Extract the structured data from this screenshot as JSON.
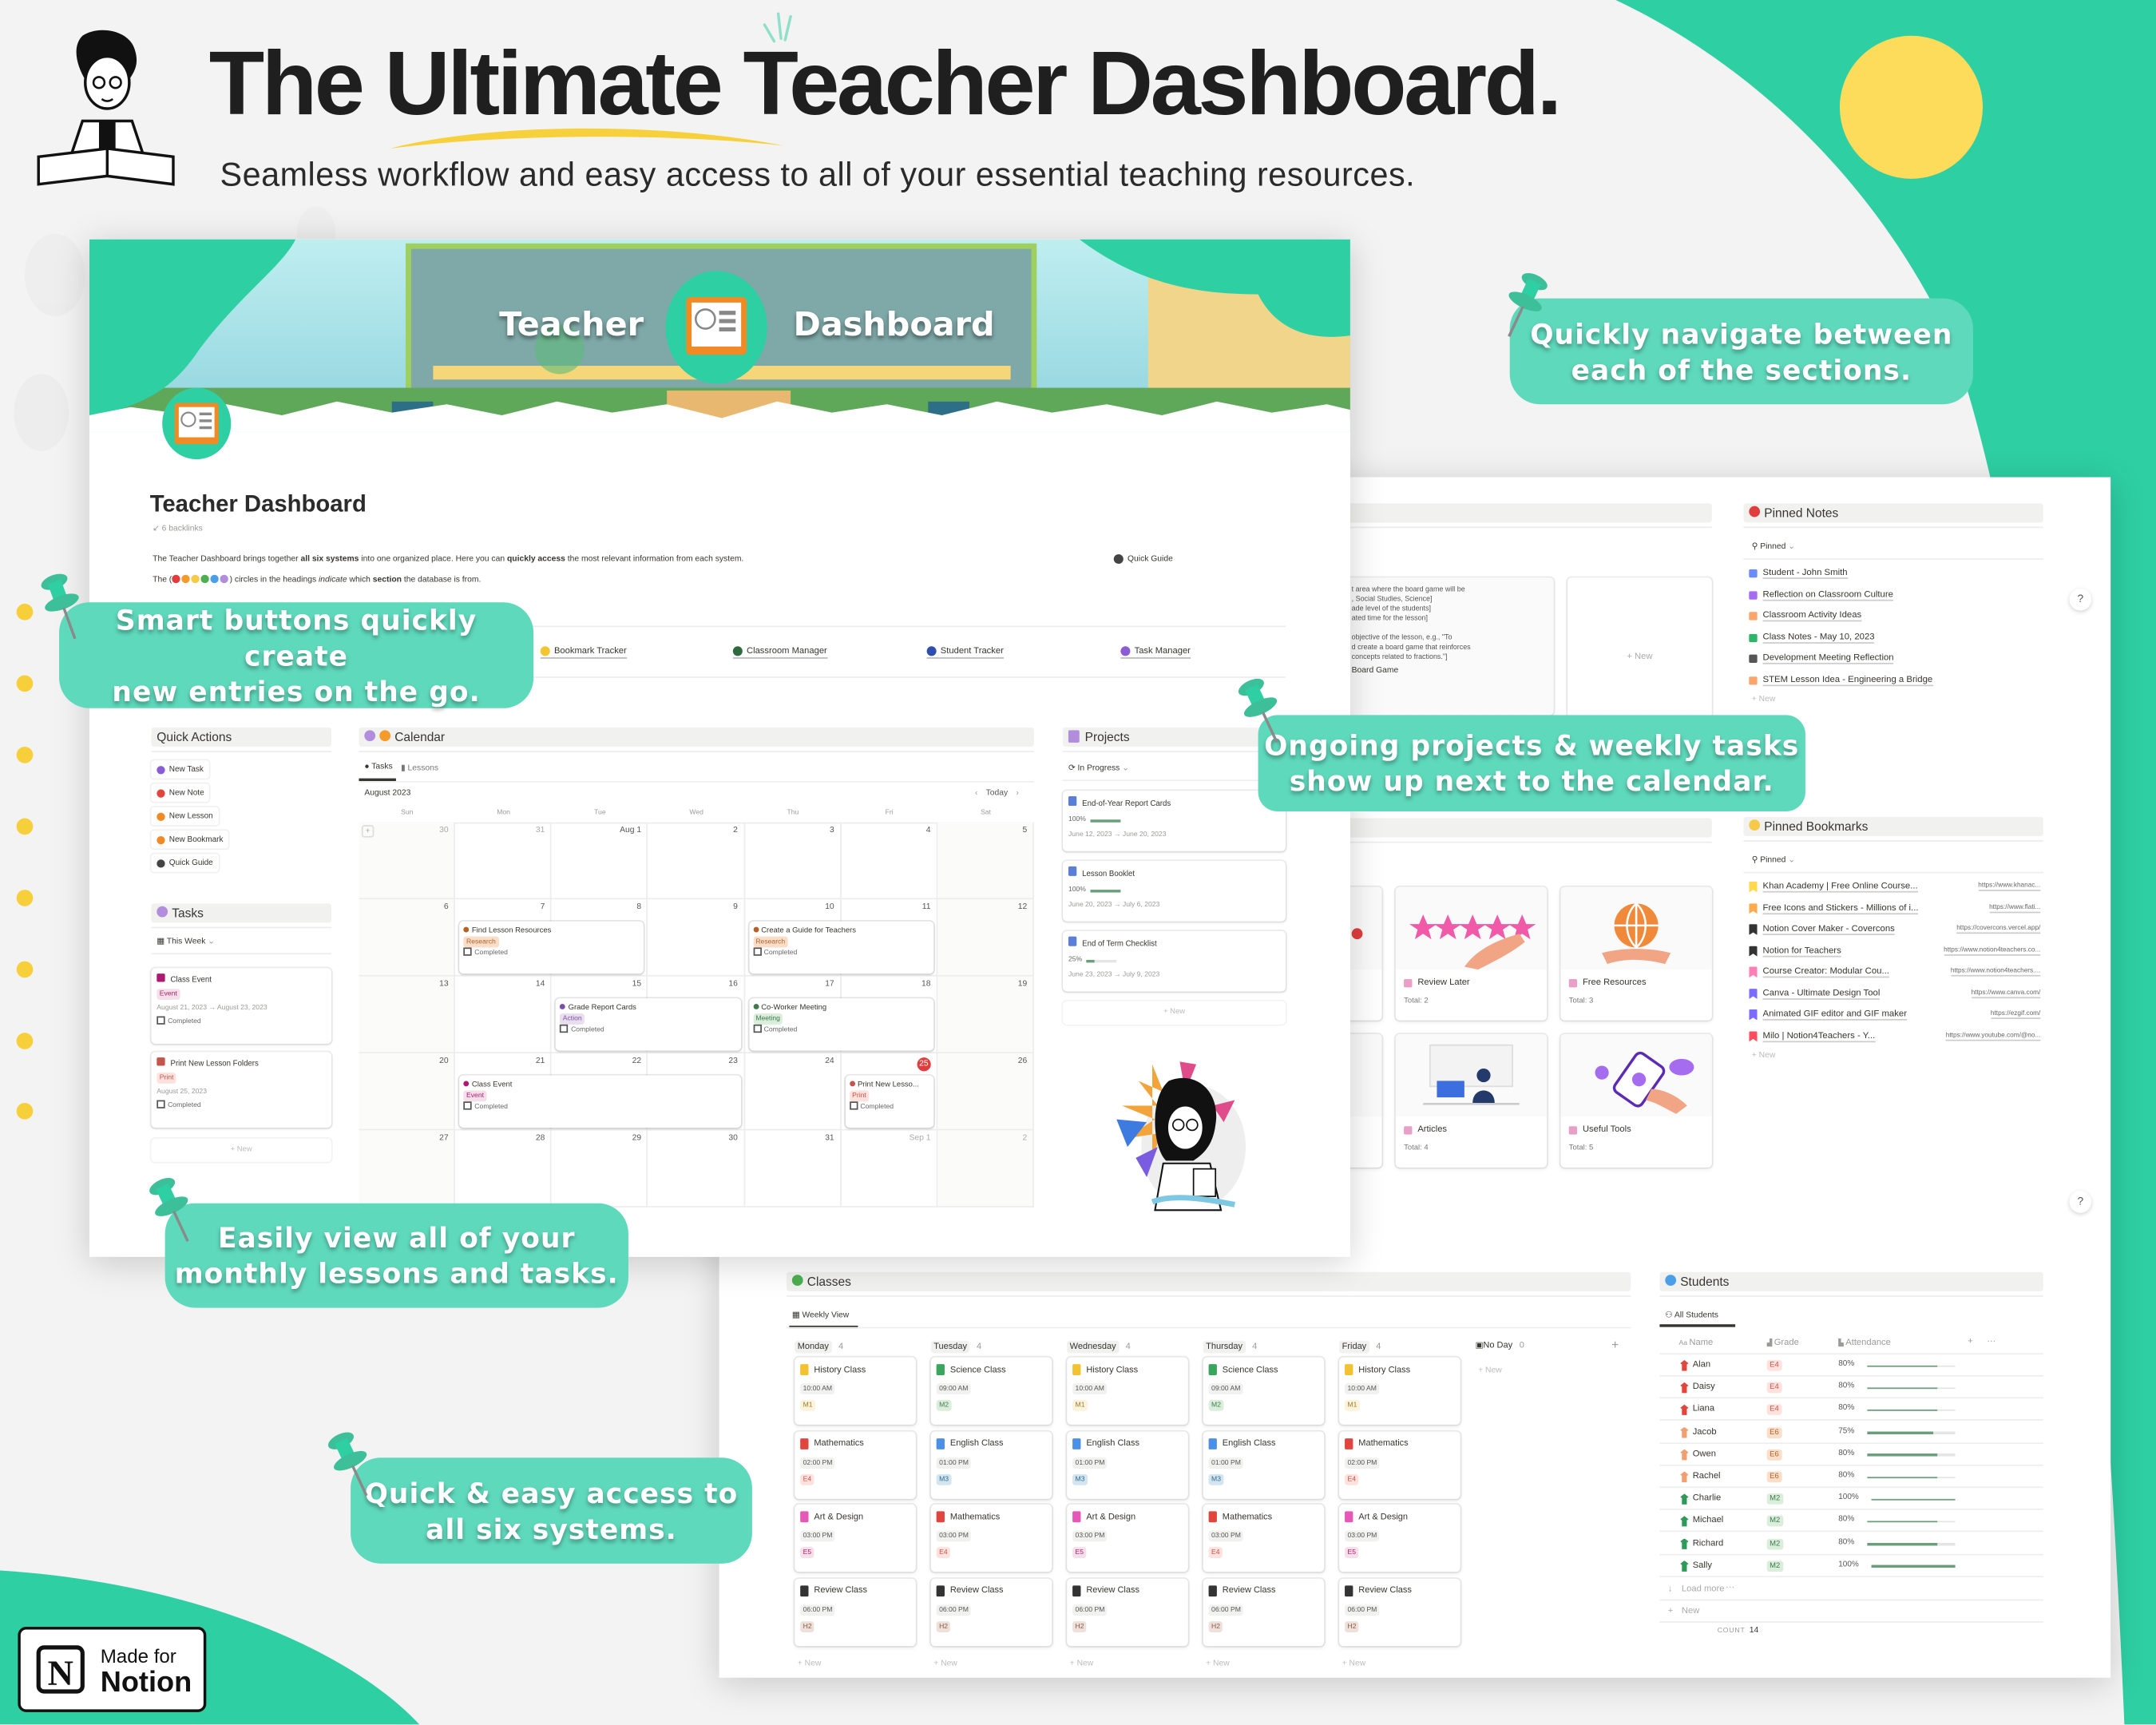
{
  "header": {
    "title_pre": "The ",
    "title_highlight": "Ultimate",
    "title_post": " Teacher Dashboard.",
    "subtitle": "Seamless workflow and easy access to all of your essential teaching resources."
  },
  "colors": {
    "teal": "#2ecfa3",
    "callout": "#5fd9bc",
    "yellow": "#fddc5c",
    "today": "#e03e3e",
    "progress": "#6b9e7c"
  },
  "callouts": [
    {
      "line1": "Quickly navigate between",
      "line2": "each of the sections."
    },
    {
      "line1": "Smart buttons quickly create",
      "line2": "new entries on the go."
    },
    {
      "line1": "Ongoing projects & weekly tasks",
      "line2": "show up next to the calendar."
    },
    {
      "line1": "Easily view all of your",
      "line2": "monthly lessons and tasks."
    },
    {
      "line1": "Quick & easy access to",
      "line2": "all six systems."
    }
  ],
  "badge": {
    "line1": "Made for",
    "line2": "Notion"
  },
  "dashboard": {
    "banner": {
      "left": "Teacher",
      "right": "Dashboard"
    },
    "title": "Teacher Dashboard",
    "backlinks": "6 backlinks",
    "description": {
      "p1": "The Teacher Dashboard brings together ",
      "b1": "all six systems",
      "p2": " into one organized place. Here you can ",
      "b2": "quickly access",
      "p3": " the most relevant information from each system."
    },
    "legend": {
      "p1": "The (",
      "p2": ") circles in the headings ",
      "italic": "indicate",
      "p3": " which ",
      "bold": "section",
      "p4": " the database is from.",
      "circle_colors": [
        "#e03e3e",
        "#f59b2b",
        "#f7c948",
        "#4caf50",
        "#4a9fe8",
        "#b28ddc"
      ]
    },
    "quick_guide": "Quick Guide",
    "systems": [
      {
        "label": "Note Tracker",
        "color": "#6a9a6a"
      },
      {
        "label": "Lesson Planner",
        "color": "#8aa86a"
      },
      {
        "label": "Bookmark Tracker",
        "color": "#f3c531"
      },
      {
        "label": "Classroom Manager",
        "color": "#2f6b3f"
      },
      {
        "label": "Student Tracker",
        "color": "#2f4fb0"
      },
      {
        "label": "Task Manager",
        "color": "#8a5cd6"
      }
    ],
    "quick_actions": {
      "title": "Quick Actions",
      "items": [
        {
          "label": "New Task",
          "icon": "check-circle",
          "color": "#8a5cd6"
        },
        {
          "label": "New Note",
          "icon": "note",
          "color": "#e0463e"
        },
        {
          "label": "New Lesson",
          "icon": "book",
          "color": "#f08a24"
        },
        {
          "label": "New Bookmark",
          "icon": "bookmark",
          "color": "#f08a24"
        },
        {
          "label": "Quick Guide",
          "icon": "info",
          "color": "#444444"
        }
      ]
    },
    "tasks": {
      "title": "Tasks",
      "view": "This Week",
      "cards": [
        {
          "title": "Class Event",
          "tag": "Event",
          "tag_bg": "#f5e0e9",
          "tag_fg": "#ad1a72",
          "date": "August 21, 2023 → August 23, 2023",
          "check": "Completed"
        },
        {
          "title": "Print New Lesson Folders",
          "tag": "Print",
          "tag_bg": "#ffe2dd",
          "tag_fg": "#c4554d",
          "date": "August 25, 2023",
          "check": "Completed"
        }
      ],
      "new": "New"
    },
    "calendar": {
      "title": "Calendar",
      "tabs": [
        "Tasks",
        "Lessons"
      ],
      "month": "August 2023",
      "today_label": "Today",
      "today": 25,
      "days": [
        "Sun",
        "Mon",
        "Tue",
        "Wed",
        "Thu",
        "Fri",
        "Sat"
      ],
      "weeks": [
        [
          "30",
          "31",
          "Aug 1",
          "2",
          "3",
          "4",
          "5"
        ],
        [
          "6",
          "7",
          "8",
          "9",
          "10",
          "11",
          "12"
        ],
        [
          "13",
          "14",
          "15",
          "16",
          "17",
          "18",
          "19"
        ],
        [
          "20",
          "21",
          "22",
          "23",
          "24",
          "25",
          "26"
        ],
        [
          "27",
          "28",
          "29",
          "30",
          "31",
          "Sep 1",
          "2"
        ]
      ],
      "events": [
        {
          "title": "Find Lesson Resources",
          "start": 7,
          "end": 8,
          "tag": "Research",
          "tag_bg": "#fadec9",
          "tag_fg": "#b0642a",
          "check": "Completed"
        },
        {
          "title": "Create a Guide for Teachers",
          "start": 10,
          "end": 11,
          "tag": "Research",
          "tag_bg": "#fadec9",
          "tag_fg": "#b0642a",
          "check": "Completed"
        },
        {
          "title": "Grade Report Cards",
          "start": 15,
          "end": 16,
          "tag": "Action",
          "tag_bg": "#e8deee",
          "tag_fg": "#7d4fa8",
          "check": "Completed"
        },
        {
          "title": "Co-Worker Meeting",
          "start": 17,
          "end": 18,
          "tag": "Meeting",
          "tag_bg": "#dbeddb",
          "tag_fg": "#3f7a4f",
          "check": "Completed"
        },
        {
          "title": "Class Event",
          "start": 21,
          "end": 23,
          "tag": "Event",
          "tag_bg": "#f5e0e9",
          "tag_fg": "#ad1a72",
          "check": "Completed"
        },
        {
          "title": "Print New Lesso...",
          "start": 25,
          "end": 25,
          "tag": "Print",
          "tag_bg": "#ffe2dd",
          "tag_fg": "#c4554d",
          "check": "Completed"
        }
      ]
    },
    "projects": {
      "title": "Projects",
      "view": "In Progress",
      "cards": [
        {
          "title": "End-of-Year Report Cards",
          "progress": 100,
          "progress_label": "100%",
          "dates": "June 12, 2023 → June 20, 2023"
        },
        {
          "title": "Lesson Booklet",
          "progress": 100,
          "progress_label": "100%",
          "dates": "June 20, 2023 → July 6, 2023"
        },
        {
          "title": "End of Term Checklist",
          "progress": 25,
          "progress_label": "25%",
          "dates": "June 23, 2023 → July 9, 2023"
        }
      ],
      "new": "New"
    }
  },
  "workspace": {
    "lesson_preview": [
      "t area where the board game will be",
      ", Social Studies, Science]",
      "ade level of the students]",
      "ated time for the lesson]",
      "objective of the lesson, e.g., \"To",
      "d create a board game that reinforces",
      "concepts related to fractions.\"]"
    ],
    "lesson_title": "Board Game",
    "new": "New",
    "help": "?",
    "pinned_notes": {
      "title": "Pinned Notes",
      "view": "Pinned",
      "items": [
        {
          "label": "Student - John Smith",
          "color": "#6b8cff"
        },
        {
          "label": "Reflection on Classroom Culture",
          "color": "#a56cf0"
        },
        {
          "label": "Classroom Activity Ideas",
          "color": "#f9a56b"
        },
        {
          "label": "Class Notes - May 10, 2023",
          "color": "#2fb56a"
        },
        {
          "label": "Development Meeting Reflection",
          "color": "#555555"
        },
        {
          "label": "STEM Lesson Idea - Engineering a Bridge",
          "color": "#f9a56b"
        }
      ],
      "new": "New"
    },
    "gallery": [
      {
        "label": "Review Later",
        "total": "Total: 2",
        "image": "stars-hand"
      },
      {
        "label": "Free Resources",
        "total": "Total: 3",
        "image": "globe-hand"
      },
      {
        "label": "Articles",
        "total": "Total: 4",
        "image": "person-at-desk"
      },
      {
        "label": "Useful Tools",
        "total": "Total: 5",
        "image": "phone-hand"
      }
    ],
    "pinned_bookmarks": {
      "title": "Pinned Bookmarks",
      "view": "Pinned",
      "items": [
        {
          "label": "Khan Academy | Free Online Course...",
          "url": "https://www.khanac...",
          "color": "#ffd84d"
        },
        {
          "label": "Free Icons and Stickers - Millions of i...",
          "url": "https://www.flati...",
          "color": "#ffa94d"
        },
        {
          "label": "Notion Cover Maker - Covercons",
          "url": "https://covercons.vercel.app/",
          "color": "#333333"
        },
        {
          "label": "Notion for Teachers",
          "url": "https://www.notion4teachers.co...",
          "color": "#333333"
        },
        {
          "label": "Course Creator: Modular Cou...",
          "url": "https://www.notion4teachers....",
          "color": "#ff7eb6"
        },
        {
          "label": "Canva - Ultimate Design Tool",
          "url": "https://www.canva.com/",
          "color": "#7b6cff"
        },
        {
          "label": "Animated GIF editor and GIF maker",
          "url": "https://ezgif.com/",
          "color": "#7b6cff"
        },
        {
          "label": "Milo | Notion4Teachers - Y...",
          "url": "https://www.youtube.com/@no...",
          "color": "#ff4d5e"
        }
      ],
      "new": "New"
    },
    "classes": {
      "title": "Classes",
      "view": "Weekly View",
      "columns": [
        {
          "day": "Monday",
          "count": "4",
          "cards": [
            {
              "title": "History Class",
              "time": "10:00 AM",
              "room": "M1",
              "icon": "scroll"
            },
            {
              "title": "Mathematics",
              "time": "02:00 PM",
              "room": "E4",
              "icon": "calculator"
            },
            {
              "title": "Art & Design",
              "time": "03:00 PM",
              "room": "E5",
              "icon": "paintbrush"
            },
            {
              "title": "Review Class",
              "time": "06:00 PM",
              "room": "H2",
              "icon": "notebook"
            }
          ]
        },
        {
          "day": "Tuesday",
          "count": "4",
          "cards": [
            {
              "title": "Science Class",
              "time": "09:00 AM",
              "room": "M2",
              "icon": "flask"
            },
            {
              "title": "English Class",
              "time": "01:00 PM",
              "room": "M3",
              "icon": "blue-book"
            },
            {
              "title": "Mathematics",
              "time": "03:00 PM",
              "room": "E4",
              "icon": "calculator"
            },
            {
              "title": "Review Class",
              "time": "06:00 PM",
              "room": "H2",
              "icon": "notebook"
            }
          ]
        },
        {
          "day": "Wednesday",
          "count": "4",
          "cards": [
            {
              "title": "History Class",
              "time": "10:00 AM",
              "room": "M1",
              "icon": "scroll"
            },
            {
              "title": "English Class",
              "time": "01:00 PM",
              "room": "M3",
              "icon": "blue-book"
            },
            {
              "title": "Art & Design",
              "time": "03:00 PM",
              "room": "E5",
              "icon": "paintbrush"
            },
            {
              "title": "Review Class",
              "time": "06:00 PM",
              "room": "H2",
              "icon": "notebook"
            }
          ]
        },
        {
          "day": "Thursday",
          "count": "4",
          "cards": [
            {
              "title": "Science Class",
              "time": "09:00 AM",
              "room": "M2",
              "icon": "flask"
            },
            {
              "title": "English Class",
              "time": "01:00 PM",
              "room": "M3",
              "icon": "blue-book"
            },
            {
              "title": "Mathematics",
              "time": "03:00 PM",
              "room": "E4",
              "icon": "calculator"
            },
            {
              "title": "Review Class",
              "time": "06:00 PM",
              "room": "H2",
              "icon": "notebook"
            }
          ]
        },
        {
          "day": "Friday",
          "count": "4",
          "cards": [
            {
              "title": "History Class",
              "time": "10:00 AM",
              "room": "M1",
              "icon": "scroll"
            },
            {
              "title": "Mathematics",
              "time": "02:00 PM",
              "room": "E4",
              "icon": "calculator"
            },
            {
              "title": "Art & Design",
              "time": "03:00 PM",
              "room": "E5",
              "icon": "paintbrush"
            },
            {
              "title": "Review Class",
              "time": "06:00 PM",
              "room": "H2",
              "icon": "notebook"
            }
          ]
        }
      ],
      "no_day": {
        "label": "No Day",
        "count": "0"
      },
      "new": "New",
      "room_colors": {
        "M1": [
          "#fbf3db",
          "#9a7b2c"
        ],
        "M2": [
          "#dbeddb",
          "#3f7a4f"
        ],
        "M3": [
          "#d3e5ef",
          "#2f6a8f"
        ],
        "E4": [
          "#ffe2dd",
          "#c4554d"
        ],
        "E5": [
          "#f5e0e9",
          "#ad1a72"
        ],
        "E6": [
          "#fadec9",
          "#b0642a"
        ],
        "H2": [
          "#eee0da",
          "#8a5a44"
        ]
      },
      "icon_colors": {
        "scroll": "#f2c230",
        "calculator": "#e0463e",
        "paintbrush": "#e458b7",
        "notebook": "#333333",
        "flask": "#3aa55d",
        "blue-book": "#4a8fe8"
      }
    },
    "students": {
      "title": "Students",
      "view": "All Students",
      "columns": [
        "Name",
        "Grade",
        "Attendance"
      ],
      "rows": [
        {
          "name": "Alan",
          "grade": "E4",
          "attendance": 80,
          "label": "80%"
        },
        {
          "name": "Daisy",
          "grade": "E4",
          "attendance": 80,
          "label": "80%"
        },
        {
          "name": "Liana",
          "grade": "E4",
          "attendance": 80,
          "label": "80%"
        },
        {
          "name": "Jacob",
          "grade": "E6",
          "attendance": 75,
          "label": "75%"
        },
        {
          "name": "Owen",
          "grade": "E6",
          "attendance": 80,
          "label": "80%"
        },
        {
          "name": "Rachel",
          "grade": "E6",
          "attendance": 80,
          "label": "80%"
        },
        {
          "name": "Charlie",
          "grade": "M2",
          "attendance": 100,
          "label": "100%"
        },
        {
          "name": "Michael",
          "grade": "M2",
          "attendance": 80,
          "label": "80%"
        },
        {
          "name": "Richard",
          "grade": "M2",
          "attendance": 80,
          "label": "80%"
        },
        {
          "name": "Sally",
          "grade": "M2",
          "attendance": 100,
          "label": "100%"
        }
      ],
      "load_more": "Load more",
      "new": "New",
      "count_label": "COUNT",
      "count": "14"
    }
  }
}
